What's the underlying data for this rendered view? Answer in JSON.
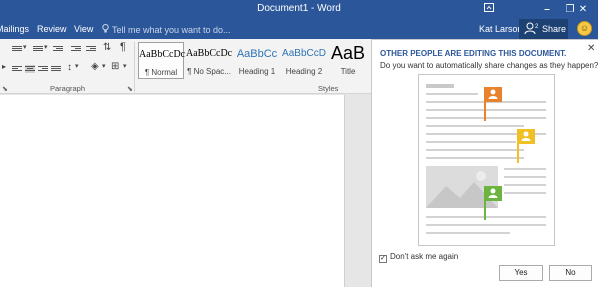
{
  "window": {
    "title": "Document1 - Word",
    "controls": {
      "ribbon_options_icon": "ribbon-display-options-icon",
      "minimize": "–",
      "restore": "❐",
      "close": "✕"
    }
  },
  "tabs": [
    {
      "label": "Mailings"
    },
    {
      "label": "Review"
    },
    {
      "label": "View"
    }
  ],
  "tell_me": {
    "text": "Tell me what you want to do..."
  },
  "account": {
    "user": "Kat Larson",
    "share_label": "Share"
  },
  "ribbon": {
    "groups": {
      "paragraph": "Paragraph",
      "styles": "Styles"
    },
    "styles": [
      {
        "preview": "AaBbCcDc",
        "name": "¶ Normal",
        "selected": true
      },
      {
        "preview": "AaBbCcDc",
        "name": "¶ No Spac..."
      },
      {
        "preview": "AaBbCc",
        "name": "Heading 1"
      },
      {
        "preview": "AaBbCcD",
        "name": "Heading 2"
      },
      {
        "preview": "AaB",
        "name": "Title"
      }
    ]
  },
  "notification": {
    "heading": "OTHER PEOPLE ARE EDITING THIS DOCUMENT.",
    "question": "Do you want to automatically share changes as they happen?",
    "dont_ask": "Don't ask me again",
    "dont_ask_checked": true,
    "yes": "Yes",
    "no": "No",
    "close": "✕"
  },
  "colors": {
    "title_bar": "#2b579a",
    "share_button": "#1e4173",
    "flag_orange": "#e8822c",
    "flag_yellow": "#f0c125",
    "flag_green": "#6db33f"
  }
}
